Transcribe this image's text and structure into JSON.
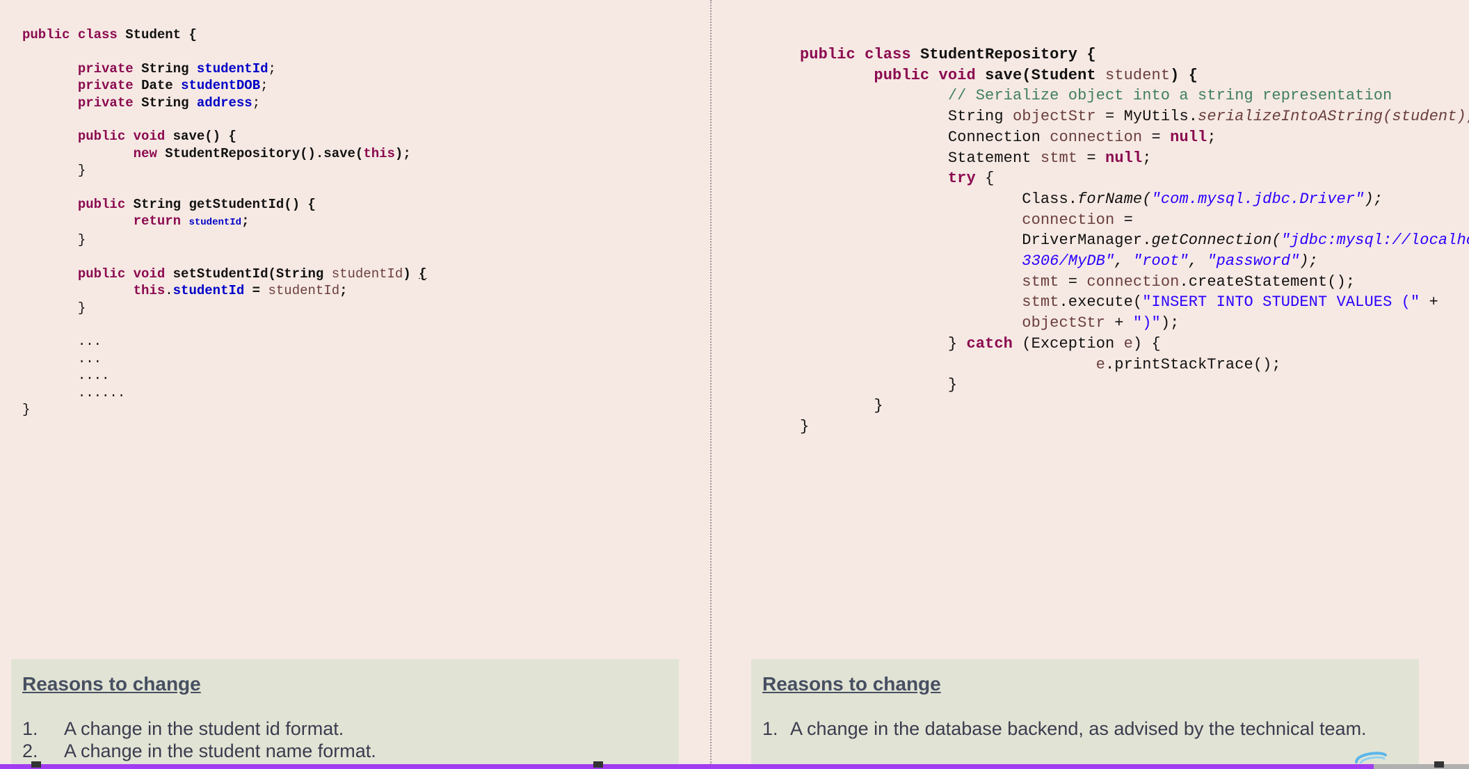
{
  "left_code": {
    "class_decl": {
      "kw": "public class",
      "name": "Student {"
    },
    "field1": {
      "kw": "private",
      "type": "String",
      "name": "studentId"
    },
    "field2": {
      "kw": "private",
      "type": "Date",
      "name": "studentDOB"
    },
    "field3": {
      "kw": "private",
      "type": "String",
      "name": "address"
    },
    "save_sig": {
      "kw": "public void",
      "rest": "save() {"
    },
    "save_body": {
      "kw": "new",
      "call": "StudentRepository().save(",
      "arg": "this",
      "end": ");"
    },
    "brace": "}",
    "getter_sig": {
      "kw": "public",
      "rest": "String getStudentId() {"
    },
    "getter_body": {
      "kw": "return",
      "val": "studentId",
      "end": ";"
    },
    "setter_sig": {
      "kw": "public void",
      "rest": "setStudentId(String",
      "param": "studentId",
      "end": ")",
      "brace": "{"
    },
    "setter_body": {
      "kw": "this",
      "field": "studentId",
      "eq": " = ",
      "val": "studentId",
      "end": ";"
    },
    "dots": [
      "...",
      "...",
      "....",
      "......"
    ],
    "closing": "}"
  },
  "right_code": {
    "class_decl": {
      "kw": "public class",
      "name": "StudentRepository {"
    },
    "method": {
      "kw": "public void",
      "rest": "save(Student",
      "param": "student",
      "end": ") {"
    },
    "comment": "// Serialize object into a string representation",
    "l_objstr": {
      "type": "String",
      "var": "objectStr",
      "mid": " = MyUtils.",
      "call": "serializeIntoAString(student);"
    },
    "l_conn": {
      "type": "Connection",
      "var": "connection",
      "mid": " = ",
      "kw": "null",
      "end": ";"
    },
    "l_stmt": {
      "type": "Statement",
      "var": "stmt",
      "mid": " = ",
      "kw": "null",
      "end": ";"
    },
    "l_try": {
      "kw": "try",
      "end": " {"
    },
    "l_forname": {
      "pre": "Class.",
      "call": "forName(",
      "str": "\"com.mysql.jdbc.Driver\"",
      "end": ");"
    },
    "l_conn2": {
      "var": "connection",
      "end": " ="
    },
    "l_getconn": {
      "pre": "DriverManager.",
      "call": "getConnection(",
      "str": "\"jdbc:mysql://localhost:"
    },
    "l_getconn2": {
      "str1": "3306/MyDB\"",
      "sep1": ", ",
      "str2": "\"root\"",
      "sep2": ", ",
      "str3": "\"password\"",
      "end": ");"
    },
    "l_create": {
      "var": "stmt",
      "mid": " = ",
      "var2": "connection",
      "end": ".createStatement();"
    },
    "l_exec": {
      "var": "stmt",
      "mid": ".execute(",
      "str": "\"INSERT INTO STUDENT VALUES (\"",
      "end": " +"
    },
    "l_exec2": {
      "var": "objectStr",
      "mid": " + ",
      "str": "\")\"",
      "end": ");"
    },
    "l_catch": {
      "pre": "} ",
      "kw": "catch",
      "mid": " (Exception ",
      "var": "e",
      "end": ") {"
    },
    "l_print": {
      "var": "e",
      "end": ".printStackTrace();"
    },
    "brace": "}"
  },
  "reasons_left": {
    "title": "Reasons to change",
    "items": [
      {
        "num": "1.",
        "text": "A change in the student id format."
      },
      {
        "num": "2.",
        "text": "A change in the student name format."
      }
    ]
  },
  "reasons_right": {
    "title": "Reasons to change",
    "items": [
      {
        "num": "1.",
        "text": "A change in the database backend, as advised by the technical team."
      }
    ]
  },
  "progress": {
    "fraction": 0.935,
    "fill_color": "#a23cf0"
  },
  "colors": {
    "background": "#f6e9e3",
    "keyword": "#8b0a50",
    "field": "#0000c8",
    "string": "#2a00ff",
    "comment": "#3f7f5f",
    "reason_box": "#e1e4d4"
  }
}
